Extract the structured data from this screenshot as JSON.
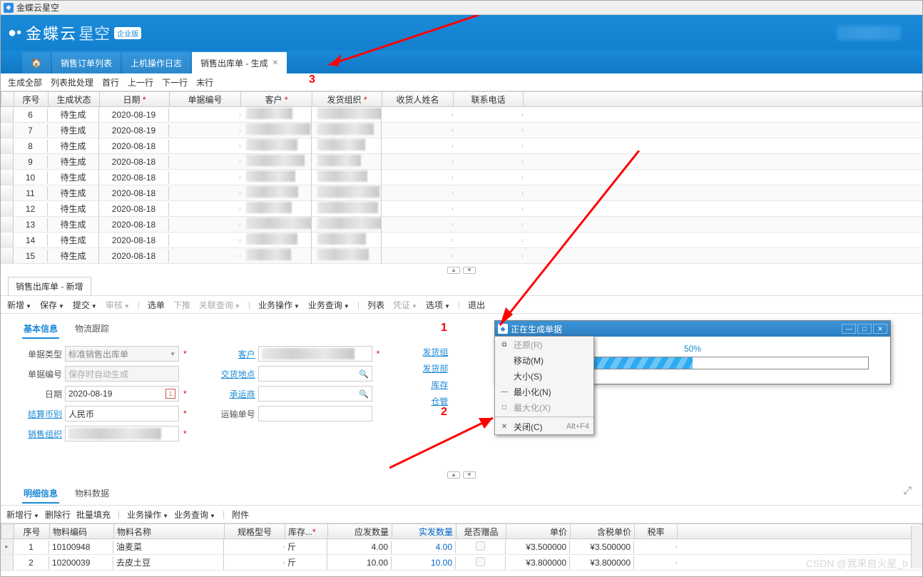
{
  "app_title": "金蝶云星空",
  "brand_main": "金蝶云",
  "brand_sub": "星空",
  "edition_badge": "企业版",
  "tabs": {
    "t1": "销售订单列表",
    "t2": "上机操作日志",
    "t3": "销售出库单 - 生成"
  },
  "toolbar1": {
    "gen_all": "生成全部",
    "batch": "列表批处理",
    "first": "首行",
    "prev": "上一行",
    "next": "下一行",
    "last": "末行"
  },
  "grid": {
    "headers": {
      "seq": "序号",
      "status": "生成状态",
      "date": "日期",
      "docno": "单据编号",
      "cust": "客户",
      "org": "发货组织",
      "recv": "收货人姓名",
      "phone": "联系电话"
    },
    "rows": [
      {
        "seq": "6",
        "status": "待生成",
        "date": "2020-08-19"
      },
      {
        "seq": "7",
        "status": "待生成",
        "date": "2020-08-19"
      },
      {
        "seq": "8",
        "status": "待生成",
        "date": "2020-08-18"
      },
      {
        "seq": "9",
        "status": "待生成",
        "date": "2020-08-18"
      },
      {
        "seq": "10",
        "status": "待生成",
        "date": "2020-08-18"
      },
      {
        "seq": "11",
        "status": "待生成",
        "date": "2020-08-18"
      },
      {
        "seq": "12",
        "status": "待生成",
        "date": "2020-08-18"
      },
      {
        "seq": "13",
        "status": "待生成",
        "date": "2020-08-18"
      },
      {
        "seq": "14",
        "status": "待生成",
        "date": "2020-08-18"
      },
      {
        "seq": "15",
        "status": "待生成",
        "date": "2020-08-18"
      }
    ]
  },
  "section_title": "销售出库单 - 新增",
  "form_toolbar": {
    "new": "新增",
    "save": "保存",
    "submit": "提交",
    "audit": "审核",
    "select": "选单",
    "push": "下推",
    "relq": "关联查询",
    "bizop": "业务操作",
    "bizq": "业务查询",
    "list": "列表",
    "voucher": "凭证",
    "opt": "选项",
    "exit": "退出"
  },
  "form_subtabs": {
    "basic": "基本信息",
    "track": "物流跟踪"
  },
  "form": {
    "type_label": "单据类型",
    "type_val": "标准销售出库单",
    "docno_label": "单据编号",
    "docno_ph": "保存时自动生成",
    "date_label": "日期",
    "date_val": "2020-08-19",
    "curr_label": "结算币别",
    "curr_val": "人民币",
    "saleorg_label": "销售组织",
    "cust_label": "客户",
    "loc_label": "交货地点",
    "carrier_label": "承运商",
    "trackno_label": "运输单号",
    "shiporg_label": "发货组",
    "shipdept_label": "发货部",
    "stockst_label": "库存",
    "stockmgr_label": "仓管"
  },
  "detail_subtabs": {
    "detail": "明细信息",
    "material": "物料数据"
  },
  "detail_toolbar": {
    "addrow": "新增行",
    "delrow": "删除行",
    "batchfill": "批量填充",
    "bizop": "业务操作",
    "bizq": "业务查询",
    "attach": "附件"
  },
  "detail": {
    "headers": {
      "seq": "序号",
      "code": "物料编码",
      "name": "物料名称",
      "spec": "规格型号",
      "unit": "库存...",
      "qty1": "应发数量",
      "qty2": "实发数量",
      "gift": "是否赠品",
      "price": "单价",
      "taxprice": "含税单价",
      "taxrate": "税率"
    },
    "rows": [
      {
        "seq": "1",
        "code": "10100948",
        "name": "油麦菜",
        "unit": "斤",
        "qty1": "4.00",
        "qty2": "4.00",
        "price": "¥3.500000",
        "taxprice": "¥3.500000"
      },
      {
        "seq": "2",
        "code": "10200039",
        "name": "去皮土豆",
        "unit": "斤",
        "qty1": "10.00",
        "qty2": "10.00",
        "price": "¥3.800000",
        "taxprice": "¥3.800000"
      }
    ]
  },
  "progress": {
    "title": "正在生成单据",
    "pct": "50%",
    "fill": 50
  },
  "ctx": {
    "restore": "还原(R)",
    "move": "移动(M)",
    "size": "大小(S)",
    "min": "最小化(N)",
    "max": "最大化(X)",
    "close": "关闭(C)",
    "close_sc": "Alt+F4"
  },
  "annotations": {
    "n1": "1",
    "n2": "2",
    "n3": "3"
  },
  "watermark": "CSDN @我来自火星_b"
}
